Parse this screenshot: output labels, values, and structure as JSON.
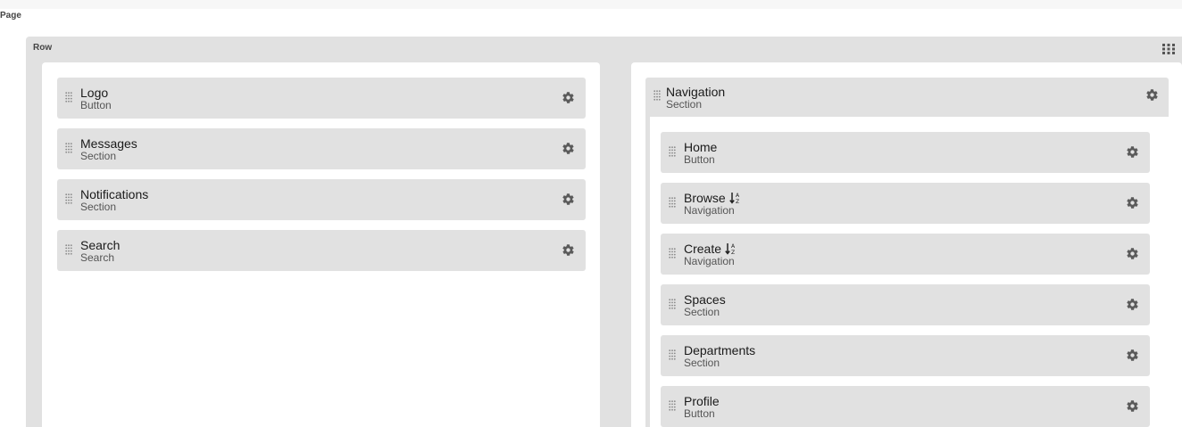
{
  "page": {
    "label": "Page"
  },
  "row": {
    "label": "Row"
  },
  "left_column": {
    "items": [
      {
        "title": "Logo",
        "subtitle": "Button"
      },
      {
        "title": "Messages",
        "subtitle": "Section"
      },
      {
        "title": "Notifications",
        "subtitle": "Section"
      },
      {
        "title": "Search",
        "subtitle": "Search"
      }
    ]
  },
  "navigation": {
    "title": "Navigation",
    "subtitle": "Section",
    "items": [
      {
        "title": "Home",
        "subtitle": "Button"
      },
      {
        "title": "Browse",
        "subtitle": "Navigation"
      },
      {
        "title": "Create",
        "subtitle": "Navigation"
      },
      {
        "title": "Spaces",
        "subtitle": "Section"
      },
      {
        "title": "Departments",
        "subtitle": "Section"
      },
      {
        "title": "Profile",
        "subtitle": "Button"
      }
    ]
  },
  "icons": {
    "drag": "drag-handle-icon",
    "settings": "gear-icon",
    "sort": "sort-alpha-icon",
    "layout": "grid-icon"
  },
  "colors": {
    "block_bg": "#e1e1e1",
    "panel_bg": "#ffffff",
    "icon": "#555555"
  }
}
